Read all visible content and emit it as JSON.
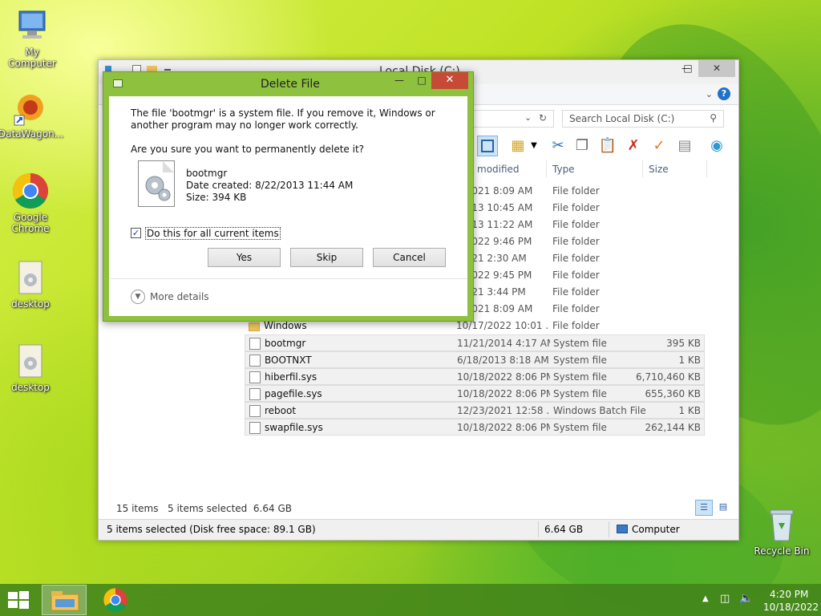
{
  "desktop": {
    "icons": [
      {
        "label": "My Computer"
      },
      {
        "label": "DataWagon..."
      },
      {
        "label": "Google Chrome"
      },
      {
        "label": "desktop"
      },
      {
        "label": "desktop"
      },
      {
        "label": "Recycle Bin"
      }
    ]
  },
  "explorer": {
    "title": "Local Disk (C:)",
    "search_placeholder": "Search Local Disk (C:)",
    "columns": {
      "modified": "modified",
      "type": "Type",
      "size": "Size"
    },
    "rows": [
      {
        "name": "",
        "date": "4/2021 8:09 AM",
        "type": "File folder",
        "size": ""
      },
      {
        "name": "",
        "date": "/2013 10:45 AM",
        "type": "File folder",
        "size": ""
      },
      {
        "name": "",
        "date": "/2013 11:22 AM",
        "type": "File folder",
        "size": ""
      },
      {
        "name": "",
        "date": "7/2022 9:46 PM",
        "type": "File folder",
        "size": ""
      },
      {
        "name": "",
        "date": "/2021 2:30 AM",
        "type": "File folder",
        "size": ""
      },
      {
        "name": "",
        "date": "7/2022 9:45 PM",
        "type": "File folder",
        "size": ""
      },
      {
        "name": "",
        "date": "/2021 3:44 PM",
        "type": "File folder",
        "size": ""
      },
      {
        "name": "",
        "date": "4/2021 8:09 AM",
        "type": "File folder",
        "size": ""
      },
      {
        "name": "Windows",
        "date": "10/17/2022 10:01 ...",
        "type": "File folder",
        "size": ""
      },
      {
        "name": "bootmgr",
        "date": "11/21/2014 4:17 AM",
        "type": "System file",
        "size": "395 KB"
      },
      {
        "name": "BOOTNXT",
        "date": "6/18/2013 8:18 AM",
        "type": "System file",
        "size": "1 KB"
      },
      {
        "name": "hiberfil.sys",
        "date": "10/18/2022 8:06 PM",
        "type": "System file",
        "size": "6,710,460 KB"
      },
      {
        "name": "pagefile.sys",
        "date": "10/18/2022 8:06 PM",
        "type": "System file",
        "size": "655,360 KB"
      },
      {
        "name": "reboot",
        "date": "12/23/2021 12:58 ...",
        "type": "Windows Batch File",
        "size": "1 KB"
      },
      {
        "name": "swapfile.sys",
        "date": "10/18/2022 8:06 PM",
        "type": "System file",
        "size": "262,144 KB"
      }
    ],
    "status_items": "15 items",
    "status_selected": "5 items selected  6.64 GB",
    "bottom_status": "5 items selected (Disk free space: 89.1 GB)",
    "bottom_size": "6.64 GB",
    "bottom_location": "Computer"
  },
  "dialog": {
    "title": "Delete File",
    "message": "The file 'bootmgr' is a system file. If you remove it, Windows or another program may no longer work correctly.",
    "question": "Are you sure you want to permanently delete it?",
    "file_name": "bootmgr",
    "file_created": "Date created: 8/22/2013 11:44 AM",
    "file_size": "Size: 394 KB",
    "checkbox_label": "Do this for all current items",
    "checkbox_checked": true,
    "yes": "Yes",
    "skip": "Skip",
    "cancel": "Cancel",
    "more_details": "More details"
  },
  "taskbar": {
    "time": "4:20 PM",
    "date": "10/18/2022"
  }
}
